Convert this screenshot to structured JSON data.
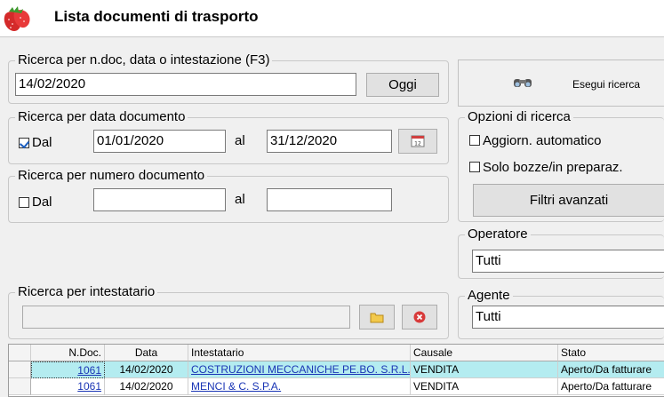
{
  "header": {
    "title": "Lista documenti di trasporto",
    "logo_icon": "strawberry-icon"
  },
  "quick_search": {
    "legend": "Ricerca per n.doc, data o intestazione (F3)",
    "value": "14/02/2020",
    "today_label": "Oggi"
  },
  "run_search": {
    "label": "Esegui ricerca",
    "icon": "binoculars-icon"
  },
  "date_search": {
    "legend": "Ricerca per data documento",
    "from_checked": true,
    "from_label": "Dal",
    "from_value": "01/01/2020",
    "to_label": "al",
    "to_value": "31/12/2020",
    "calendar_icon": "calendar-icon"
  },
  "options": {
    "legend": "Opzioni di ricerca",
    "auto_update_label": "Aggiorn. automatico",
    "drafts_label": "Solo bozze/in preparaz.",
    "advanced_filters_label": "Filtri avanzati"
  },
  "number_search": {
    "legend": "Ricerca per numero documento",
    "from_label": "Dal",
    "from_value": "",
    "to_label": "al",
    "to_value": ""
  },
  "operator": {
    "legend": "Operatore",
    "value": "Tutti"
  },
  "holder_search": {
    "legend": "Ricerca per intestatario",
    "value": "",
    "folder_icon": "folder-icon",
    "clear_icon": "clear-icon"
  },
  "agent": {
    "legend": "Agente",
    "value": "Tutti"
  },
  "table": {
    "columns": [
      "N.Doc.",
      "Data",
      "Intestatario",
      "Causale",
      "Stato"
    ],
    "rows": [
      {
        "ndoc": "1061",
        "data": "14/02/2020",
        "intestatario": "COSTRUZIONI MECCANICHE PE.BO. S.R.L.",
        "causale": "VENDITA",
        "stato": "Aperto/Da fatturare"
      },
      {
        "ndoc": "1061",
        "data": "14/02/2020",
        "intestatario": "MENCI & C. S.P.A.",
        "causale": "VENDITA",
        "stato": "Aperto/Da fatturare"
      }
    ]
  }
}
